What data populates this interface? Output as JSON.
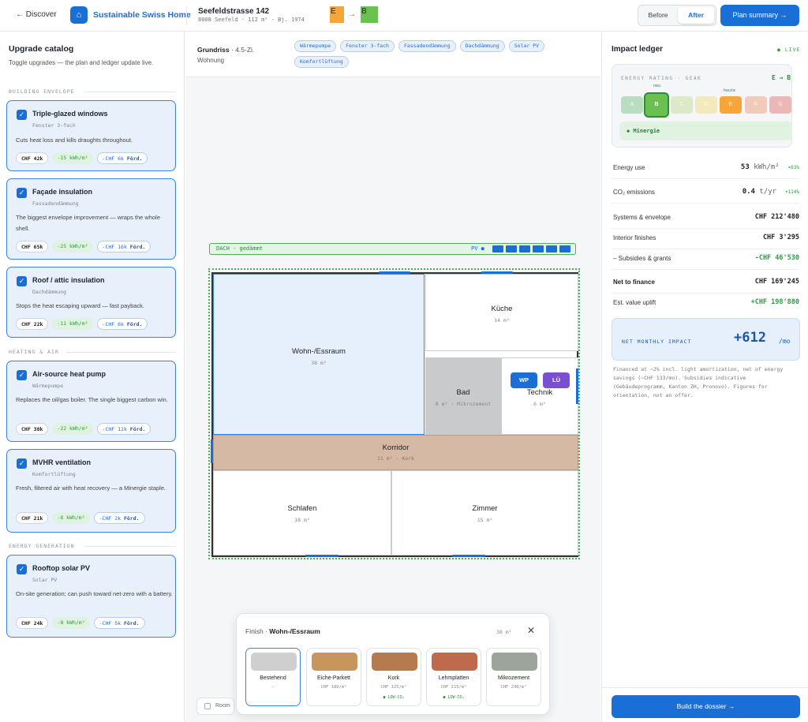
{
  "topbar": {
    "back_label": "← Discover",
    "brand_name": "Sustainable Swiss Home",
    "address": "Seefeldstrasse 142",
    "address_meta": "8008 Seefeld · 112 m² · Bj. 1974",
    "rating_from": "E",
    "rating_to": "B",
    "toggle_before": "Before",
    "toggle_after": "After",
    "toggle_active": "After",
    "plan_summary_label": "Plan summary →"
  },
  "catalog": {
    "title": "Upgrade catalog",
    "subtitle": "Toggle upgrades — the plan and ledger update live.",
    "sections": [
      "Building envelope",
      "Heating & air",
      "Energy generation"
    ],
    "items": [
      {
        "name": "Triple-glazed windows",
        "de": "Fenster 3-fach",
        "desc": "Cuts heat loss and kills draughts throughout.",
        "cost": "CHF 42k",
        "energy": "-15 kWh/m²",
        "subsidy": "-CHF 6k",
        "checked": true
      },
      {
        "name": "Façade insulation",
        "de": "Fassadendämmung",
        "desc": "The biggest envelope improvement — wraps the whole shell.",
        "cost": "CHF 65k",
        "energy": "-25 kWh/m²",
        "subsidy": "-CHF 16k",
        "checked": true
      },
      {
        "name": "Roof / attic insulation",
        "de": "Dachdämmung",
        "desc": "Stops the heat escaping upward — fast payback.",
        "cost": "CHF 22k",
        "energy": "-11 kWh/m²",
        "subsidy": "-CHF 6k",
        "checked": true
      },
      {
        "name": "Air-source heat pump",
        "de": "Wärmepumpe",
        "desc": "Replaces the oil/gas boiler. The single biggest carbon win.",
        "cost": "CHF 38k",
        "energy": "-22 kWh/m²",
        "subsidy": "-CHF 12k",
        "checked": true
      },
      {
        "name": "MVHR ventilation",
        "de": "Komfortlüftung",
        "desc": "Fresh, filtered air with heat recovery — a Minergie staple.",
        "cost": "CHF 21k",
        "energy": "-8 kWh/m²",
        "subsidy": "-CHF 2k",
        "checked": true
      },
      {
        "name": "Rooftop solar PV",
        "de": "Solar PV",
        "desc": "On-site generation; can push toward net-zero with a battery.",
        "cost": "CHF 24k",
        "energy": "-8 kWh/m²",
        "subsidy": "-CHF 5k",
        "checked": true
      }
    ],
    "subsidy_suffix": "Förd."
  },
  "plan": {
    "type_label": "Grundriss",
    "type_rooms": "· 4.5-Zi.",
    "home_kind": "Wohnung",
    "chips": [
      "Wärmepumpe",
      "Fenster 3-fach",
      "Fassadendämmung",
      "Dachdämmung",
      "Solar PV",
      "Komfortlüftung"
    ],
    "roof_label": "DACH · gedämmt",
    "pv_label": "PV ●",
    "rooms": [
      {
        "name": "Wohn-/Essraum",
        "area": "38 m²"
      },
      {
        "name": "Küche",
        "area": "14 m²"
      },
      {
        "name": "Bad",
        "area": "8 m² · Mikrozement"
      },
      {
        "name": "Technik",
        "area": "6 m²"
      },
      {
        "name": "Korridor",
        "area": "11 m² · Kork"
      },
      {
        "name": "Schlafen",
        "area": "18 m²"
      },
      {
        "name": "Zimmer",
        "area": "15 m²"
      }
    ],
    "badge_wp": "WP",
    "badge_lu": "LÜ",
    "room_toggle": "Room"
  },
  "finish": {
    "title_prefix": "Finish ·",
    "room": "Wohn-/Essraum",
    "area": "38 m²",
    "close": "✕",
    "materials": [
      {
        "name": "Bestehend",
        "price": "—",
        "eco": "",
        "color": "#cfcfcf"
      },
      {
        "name": "Eiche-Parkett",
        "price": "CHF 180/m²",
        "eco": "",
        "color": "#c8955c"
      },
      {
        "name": "Kork",
        "price": "CHF 125/m²",
        "eco": "● LOW-CO₂",
        "color": "#b57a4e"
      },
      {
        "name": "Lehmplatten",
        "price": "CHF 215/m²",
        "eco": "● LOW-CO₂",
        "color": "#bf6a4c"
      },
      {
        "name": "Mikrozement",
        "price": "CHF 240/m²",
        "eco": "",
        "color": "#9da49b"
      }
    ],
    "selected": "Bestehend"
  },
  "ledger": {
    "title": "Impact ledger",
    "live": "● LIVE",
    "geak_label": "ENERGY RATING · GEAK",
    "geak_change": "E → B",
    "grades": [
      "A",
      "B",
      "C",
      "D",
      "E",
      "F",
      "G"
    ],
    "grade_colors": [
      "#4cb05a",
      "#6cc04f",
      "#b3d36a",
      "#f0d54c",
      "#f6a53a",
      "#f07a4a",
      "#e0453e"
    ],
    "grade_new": "B",
    "grade_today": "E",
    "tag_new": "neu",
    "tag_today": "heute",
    "minergie": "◆ Minergie",
    "rows": {
      "energy": {
        "label": "Energy use",
        "value": "53",
        "unit": "kWh/m²",
        "delta": "▾63%"
      },
      "co2": {
        "label": "CO₂ emissions",
        "value": "0.4",
        "unit": "t/yr",
        "delta": "▾114%"
      },
      "systems": {
        "label": "Systems & envelope",
        "value": "CHF 212'480"
      },
      "interior": {
        "label": "Interior finishes",
        "value": "CHF 3'295"
      },
      "subsidies": {
        "label": "– Subsidies & grants",
        "value": "-CHF 46'530"
      },
      "net": {
        "label": "Net to finance",
        "value": "CHF 169'245"
      },
      "uplift": {
        "label": "Est. value uplift",
        "value": "+CHF 198'880"
      }
    },
    "net_monthly_label": "NET MONTHLY IMPACT",
    "net_monthly_value": "+612",
    "net_monthly_unit": "/mo",
    "fineprint": "Financed at ~2% incl. light amortization, net of energy savings (~CHF 133/mo). Subsidies indicative (Gebäudeprogramm, Kanton ZH, Pronovo). Figures for orientation, not an offer.",
    "cta": "Build the dossier →"
  },
  "colors": {
    "accent": "#1a6fd6",
    "green": "#2e9b46"
  }
}
